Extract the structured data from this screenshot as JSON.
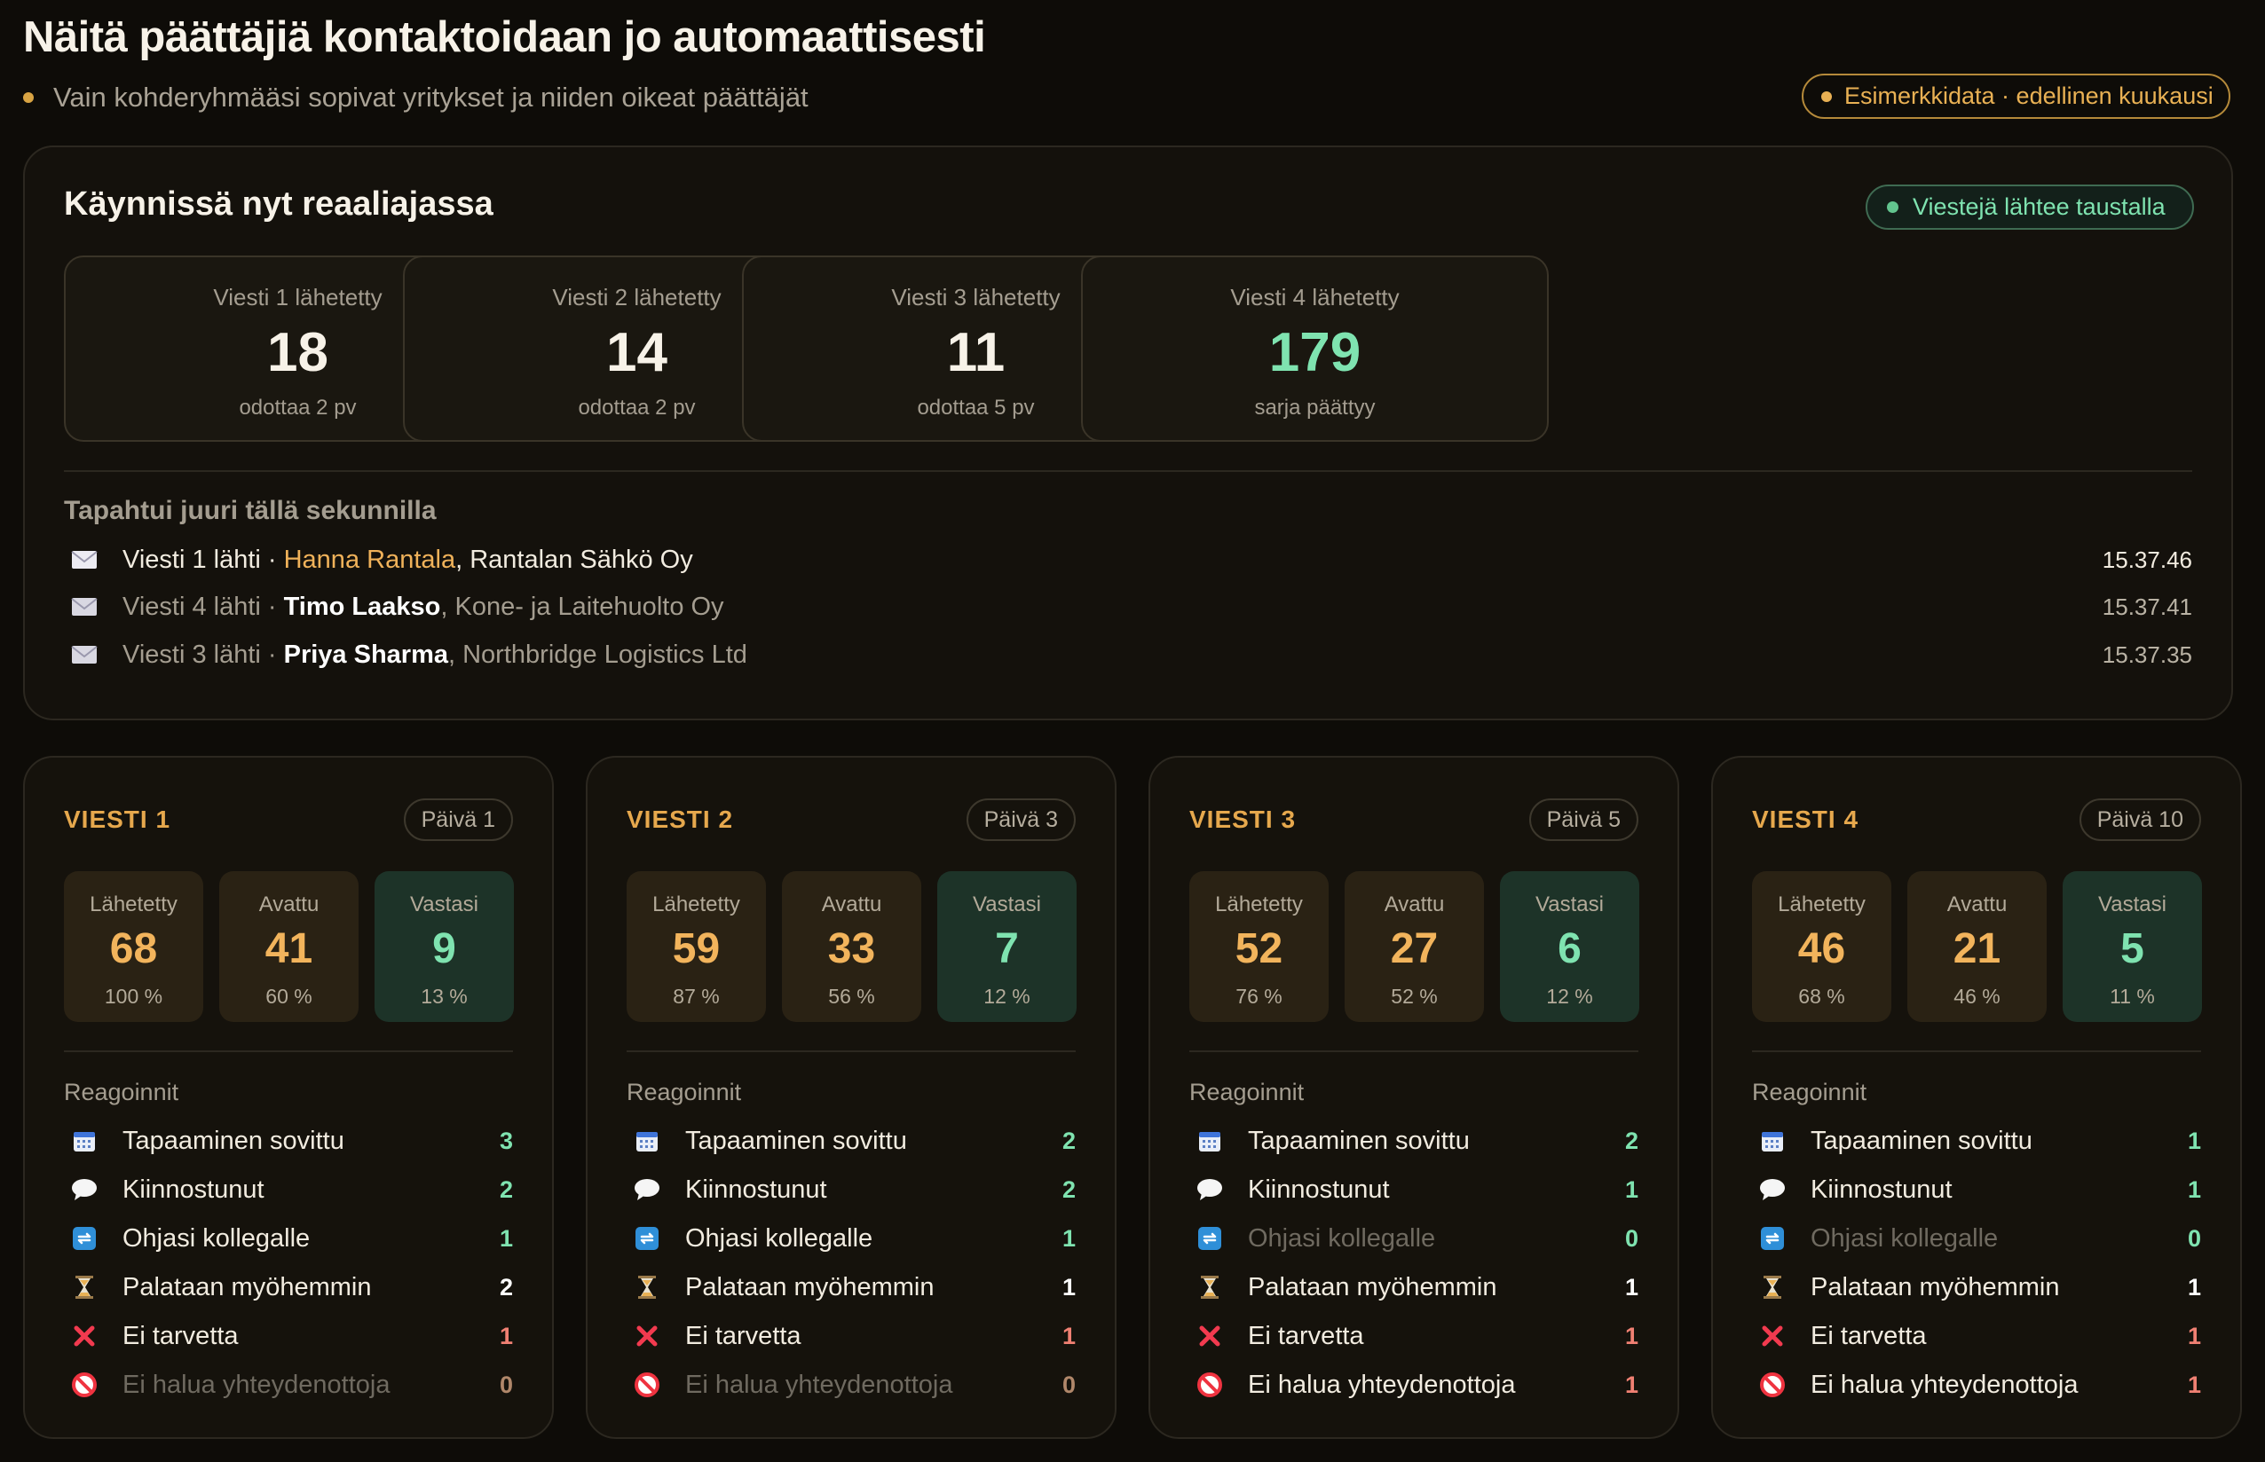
{
  "header": {
    "title": "Näitä päättäjiä kontaktoidaan jo automaattisesti",
    "subtitle": "Vain kohderyhmääsi sopivat yritykset ja niiden oikeat päättäjät",
    "sample_badge": "Esimerkkidata · edellinen kuukausi"
  },
  "live": {
    "title": "Käynnissä nyt reaaliajassa",
    "status_badge": "Viestejä lähtee taustalla",
    "steps": [
      {
        "label": "Viesti 1 lähetetty",
        "value": "18",
        "sub": "odottaa 2 pv"
      },
      {
        "label": "Viesti 2 lähetetty",
        "value": "14",
        "sub": "odottaa 2 pv"
      },
      {
        "label": "Viesti 3 lähetetty",
        "value": "11",
        "sub": "odottaa 5 pv"
      },
      {
        "label": "Viesti 4 lähetetty",
        "value": "179",
        "sub": "sarja päättyy"
      }
    ],
    "events_title": "Tapahtui juuri tällä sekunnilla",
    "events": [
      {
        "prefix": "Viesti 1 lähti · ",
        "person": "Hanna Rantala",
        "company": ", Rantalan Sähkö Oy",
        "time": "15.37.46"
      },
      {
        "prefix": "Viesti 4 lähti · ",
        "person": "Timo Laakso",
        "company": ", Kone- ja Laitehuolto Oy",
        "time": "15.37.41"
      },
      {
        "prefix": "Viesti 3 lähti · ",
        "person": "Priya Sharma",
        "company": ", Northbridge Logistics Ltd",
        "time": "15.37.35"
      }
    ]
  },
  "cards": [
    {
      "title": "VIESTI 1",
      "day": "Päivä 1",
      "metrics": [
        {
          "label": "Lähetetty",
          "value": "68",
          "pct": "100 %"
        },
        {
          "label": "Avattu",
          "value": "41",
          "pct": "60 %"
        },
        {
          "label": "Vastasi",
          "value": "9",
          "pct": "13 %"
        }
      ],
      "reactions_title": "Reagoinnit",
      "reactions": [
        {
          "icon": "calendar-icon",
          "label": "Tapaaminen sovittu",
          "value": "3"
        },
        {
          "icon": "speech-bubble-icon",
          "label": "Kiinnostunut",
          "value": "2"
        },
        {
          "icon": "forward-icon",
          "label": "Ohjasi kollegalle",
          "value": "1"
        },
        {
          "icon": "hourglass-icon",
          "label": "Palataan myöhemmin",
          "value": "2"
        },
        {
          "icon": "cross-icon",
          "label": "Ei tarvetta",
          "value": "1"
        },
        {
          "icon": "prohibited-icon",
          "label": "Ei halua yhteydenottoja",
          "value": "0"
        }
      ]
    },
    {
      "title": "VIESTI 2",
      "day": "Päivä 3",
      "metrics": [
        {
          "label": "Lähetetty",
          "value": "59",
          "pct": "87 %"
        },
        {
          "label": "Avattu",
          "value": "33",
          "pct": "56 %"
        },
        {
          "label": "Vastasi",
          "value": "7",
          "pct": "12 %"
        }
      ],
      "reactions_title": "Reagoinnit",
      "reactions": [
        {
          "icon": "calendar-icon",
          "label": "Tapaaminen sovittu",
          "value": "2"
        },
        {
          "icon": "speech-bubble-icon",
          "label": "Kiinnostunut",
          "value": "2"
        },
        {
          "icon": "forward-icon",
          "label": "Ohjasi kollegalle",
          "value": "1"
        },
        {
          "icon": "hourglass-icon",
          "label": "Palataan myöhemmin",
          "value": "1"
        },
        {
          "icon": "cross-icon",
          "label": "Ei tarvetta",
          "value": "1"
        },
        {
          "icon": "prohibited-icon",
          "label": "Ei halua yhteydenottoja",
          "value": "0"
        }
      ]
    },
    {
      "title": "VIESTI 3",
      "day": "Päivä 5",
      "metrics": [
        {
          "label": "Lähetetty",
          "value": "52",
          "pct": "76 %"
        },
        {
          "label": "Avattu",
          "value": "27",
          "pct": "52 %"
        },
        {
          "label": "Vastasi",
          "value": "6",
          "pct": "12 %"
        }
      ],
      "reactions_title": "Reagoinnit",
      "reactions": [
        {
          "icon": "calendar-icon",
          "label": "Tapaaminen sovittu",
          "value": "2"
        },
        {
          "icon": "speech-bubble-icon",
          "label": "Kiinnostunut",
          "value": "1"
        },
        {
          "icon": "forward-icon",
          "label": "Ohjasi kollegalle",
          "value": "0"
        },
        {
          "icon": "hourglass-icon",
          "label": "Palataan myöhemmin",
          "value": "1"
        },
        {
          "icon": "cross-icon",
          "label": "Ei tarvetta",
          "value": "1"
        },
        {
          "icon": "prohibited-icon",
          "label": "Ei halua yhteydenottoja",
          "value": "1"
        }
      ]
    },
    {
      "title": "VIESTI 4",
      "day": "Päivä 10",
      "metrics": [
        {
          "label": "Lähetetty",
          "value": "46",
          "pct": "68 %"
        },
        {
          "label": "Avattu",
          "value": "21",
          "pct": "46 %"
        },
        {
          "label": "Vastasi",
          "value": "5",
          "pct": "11 %"
        }
      ],
      "reactions_title": "Reagoinnit",
      "reactions": [
        {
          "icon": "calendar-icon",
          "label": "Tapaaminen sovittu",
          "value": "1"
        },
        {
          "icon": "speech-bubble-icon",
          "label": "Kiinnostunut",
          "value": "1"
        },
        {
          "icon": "forward-icon",
          "label": "Ohjasi kollegalle",
          "value": "0"
        },
        {
          "icon": "hourglass-icon",
          "label": "Palataan myöhemmin",
          "value": "1"
        },
        {
          "icon": "cross-icon",
          "label": "Ei tarvetta",
          "value": "1"
        },
        {
          "icon": "prohibited-icon",
          "label": "Ei halua yhteydenottoja",
          "value": "1"
        }
      ]
    }
  ],
  "colors": {
    "accent_orange": "#e6a84d",
    "accent_green": "#7fe3b0",
    "negative_red": "#f08073",
    "background": "#0e0c08"
  }
}
